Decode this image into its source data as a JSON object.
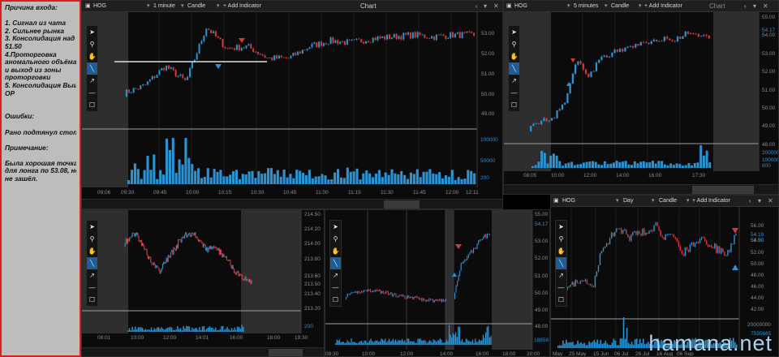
{
  "notes": {
    "lines": [
      "Причина входа:",
      "",
      "1. Сигнал из чата",
      "2. Сильнее рынка",
      "3. Консолидация над",
      "51.50",
      "4.Проторговка",
      "аномального объёма",
      "и выход из зоны",
      "проторговки",
      "5. Консолидация Выше",
      "OP",
      "",
      "",
      "Ошибки:",
      "",
      "Рано подтянул стоп.",
      "",
      "Примечание:",
      "",
      "Была хорошая точка",
      "для лонга по 53.08, но",
      "не зашёл."
    ]
  },
  "toolbar_icons": [
    "cursor-icon",
    "zoom-icon",
    "hand-icon",
    "line-icon",
    "arrow-icon",
    "hline-icon",
    "rect-icon"
  ],
  "toolbar_glyphs": [
    "➤",
    "⚲",
    "✋",
    "╲",
    "↗",
    "—",
    "☐"
  ],
  "w1": {
    "symbol": "HOG",
    "interval": "1 minute",
    "type": "Candle",
    "add": "+ Add Indicator",
    "title": "Chart",
    "price_labels": [
      "53.00",
      "52.00",
      "51.00",
      "50.00",
      "49.00"
    ],
    "vol_labels": [
      "100000",
      "50000",
      "200"
    ],
    "time_labels": [
      "09:06",
      "09:30",
      "09:45",
      "10:00",
      "10:15",
      "10:30",
      "10:45",
      "11:00",
      "11:15",
      "11:30",
      "11:45",
      "12:00",
      "12:11"
    ]
  },
  "w2": {
    "symbol": "HOG",
    "interval": "5 minutes",
    "type": "Candle",
    "add": "+ Add Indicator",
    "title": "Chart",
    "price_labels": [
      "55.00",
      "54.00",
      "53.00",
      "52.00",
      "51.00",
      "50.00",
      "49.00",
      "48.00"
    ],
    "price_current": "54.17",
    "vol_labels": [
      "200000",
      "100000",
      "800"
    ],
    "time_labels": [
      "08:05",
      "10:00",
      "12:00",
      "14:00",
      "16:00",
      "17:30"
    ]
  },
  "w3": {
    "price_labels": [
      "214.50",
      "214.20",
      "214.00",
      "213.80",
      "213.60",
      "213.50",
      "213.40",
      "213.20"
    ],
    "vol_labels": [
      "200"
    ],
    "time_labels": [
      "08:01",
      "10:00",
      "12:00",
      "14:01",
      "16:00",
      "18:00",
      "19:30"
    ]
  },
  "w4": {
    "price_labels": [
      "55.00",
      "54.17",
      "53.00",
      "52.00",
      "51.00",
      "50.00",
      "49.00",
      "48.00"
    ],
    "vol_labels": [
      "188567"
    ],
    "time_labels": [
      "08:30",
      "10:00",
      "12:00",
      "14:00",
      "16:00",
      "18:00",
      "20:00",
      "22:00"
    ],
    "time_labels2": [
      "08:00",
      "18:00",
      "23:00"
    ]
  },
  "w5": {
    "symbol": "HOG",
    "interval": "Day",
    "type": "Candle",
    "add": "+ Add Indicator",
    "price_labels": [
      "56.00",
      "54.00",
      "52.00",
      "50.00",
      "48.00",
      "46.00",
      "44.00",
      "42.00"
    ],
    "price_current": "54.19",
    "price_current2": "53.50",
    "vol_labels": [
      "20000000",
      "7595665"
    ],
    "time_labels": [
      "May",
      "25 May",
      "15 Jun",
      "06 Jul",
      "26 Jul",
      "16 Aug",
      "06 Sep"
    ]
  },
  "watermark": "hamana.net",
  "colors": {
    "up": "#2b93d4",
    "down": "#d23a3a",
    "level": "#e0e0e0",
    "bg": "#0b0b0b",
    "notes_bg": "#bdbdbd",
    "notes_border": "#d62020"
  }
}
